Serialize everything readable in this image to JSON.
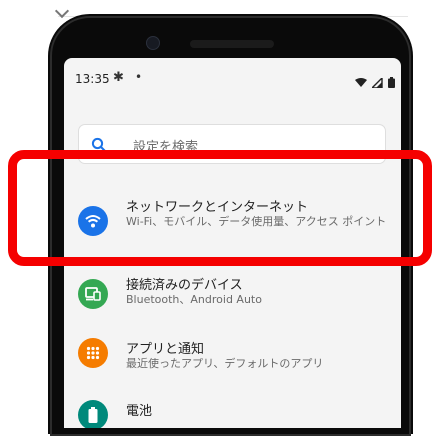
{
  "status_bar": {
    "time": "13:35",
    "gear_glyph": "✱",
    "dot_glyph": "•"
  },
  "search": {
    "placeholder": "設定を検索"
  },
  "settings_items": [
    {
      "title": "ネットワークとインターネット",
      "subtitle": "Wi-Fi、モバイル、データ使用量、アクセス ポイント",
      "icon": "wifi-icon",
      "icon_color": "#1a73e8"
    },
    {
      "title": "接続済みのデバイス",
      "subtitle": "Bluetooth、Android Auto",
      "icon": "connected-devices-icon",
      "icon_color": "#34a853"
    },
    {
      "title": "アプリと通知",
      "subtitle": "最近使ったアプリ、デフォルトのアプリ",
      "icon": "apps-icon",
      "icon_color": "#f57c00"
    },
    {
      "title": "電池",
      "subtitle": "",
      "icon": "battery-icon",
      "icon_color": "#00897b"
    }
  ],
  "colors": {
    "highlight": "#f50000",
    "screen_background": "#f4f4f4",
    "phone_body": "#0a0a0a"
  }
}
